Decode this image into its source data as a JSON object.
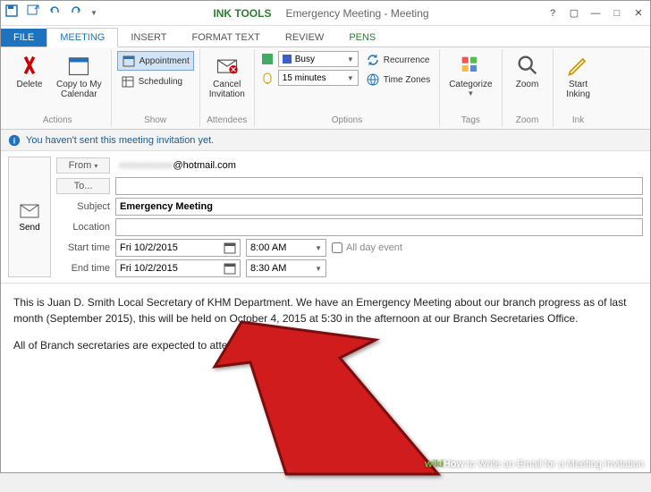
{
  "titlebar": {
    "ink_tools": "INK TOOLS",
    "title": "Emergency Meeting - Meeting"
  },
  "tabs": {
    "file": "FILE",
    "meeting": "MEETING",
    "insert": "INSERT",
    "format_text": "FORMAT TEXT",
    "review": "REVIEW",
    "pens": "PENS"
  },
  "ribbon": {
    "actions": {
      "label": "Actions",
      "delete": "Delete",
      "copy_to_cal": "Copy to My\nCalendar"
    },
    "show": {
      "label": "Show",
      "appointment": "Appointment",
      "scheduling": "Scheduling"
    },
    "attendees": {
      "label": "Attendees",
      "cancel": "Cancel\nInvitation"
    },
    "options": {
      "label": "Options",
      "busy": "Busy",
      "reminder": "15 minutes",
      "recurrence": "Recurrence",
      "time_zones": "Time Zones"
    },
    "tags": {
      "label": "Tags",
      "categorize": "Categorize"
    },
    "zoom": {
      "label": "Zoom",
      "zoom": "Zoom"
    },
    "ink": {
      "label": "Ink",
      "start": "Start\nInking"
    }
  },
  "infobar": {
    "text": "You haven't sent this meeting invitation yet."
  },
  "compose": {
    "send": "Send",
    "from_label": "From",
    "from_value": "@hotmail.com",
    "to_label": "To...",
    "to_value": "",
    "subject_label": "Subject",
    "subject_value": "Emergency Meeting",
    "location_label": "Location",
    "location_value": "",
    "start_label": "Start time",
    "start_date": "Fri 10/2/2015",
    "start_time": "8:00 AM",
    "end_label": "End time",
    "end_date": "Fri 10/2/2015",
    "end_time": "8:30 AM",
    "all_day": "All day event"
  },
  "body": {
    "p1": "This is Juan D. Smith Local Secretary of KHM Department. We have an Emergency Meeting about our branch progress as of last month (September 2015), this will be held on October 4, 2015 at 5:30 in the afternoon at our Branch Secretaries Office.",
    "p2": "All of Branch secretaries are expected to attend"
  },
  "watermark": {
    "wiki": "wiki",
    "how": "How",
    "text": "to Write an Email for a Meeting Invitation"
  }
}
